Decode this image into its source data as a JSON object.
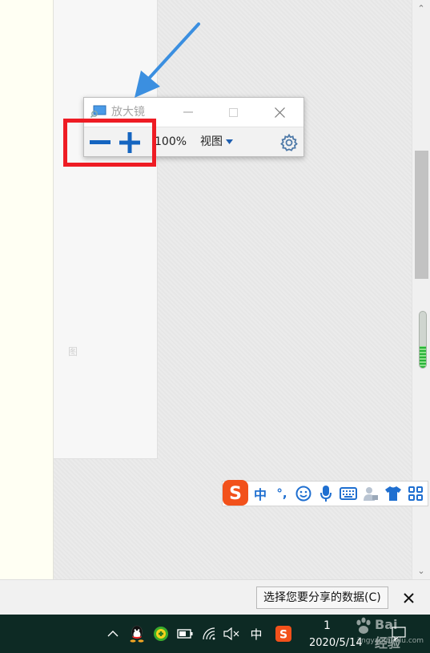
{
  "magnifier": {
    "title": "放大镜",
    "zoom_level": "100%",
    "view_menu_label": "视图",
    "icons": [
      "magnifier-app-icon",
      "minimize-icon",
      "maximize-icon",
      "close-icon",
      "zoom-out-icon",
      "zoom-in-icon",
      "dropdown-arrow-icon",
      "gear-icon"
    ]
  },
  "document": {
    "ghost_text": "图"
  },
  "scrollbar": {
    "up_glyph": "⌃",
    "down_glyph": "⌄"
  },
  "ime_toolbar": {
    "mode_label": "中",
    "punct_label": "°,",
    "icons": [
      "sogou-logo-icon",
      "emoji-icon",
      "microphone-icon",
      "keyboard-icon",
      "user-icon",
      "skin-tshirt-icon",
      "toolbox-grid-icon"
    ]
  },
  "notification": {
    "share_button_label": "选择您要分享的数据(C)",
    "close_glyph": "✕"
  },
  "taskbar": {
    "input_mode": "中",
    "time_partial": "1",
    "date": "2020/5/14",
    "icons": [
      "chevron-up-icon",
      "qq-icon",
      "360-security-icon",
      "battery-icon",
      "wifi-icon",
      "volume-muted-icon",
      "sogou-tray-icon",
      "action-center-icon"
    ]
  },
  "watermark": {
    "text": "Bai 经验",
    "url": "jingyan.baidu.com"
  },
  "colors": {
    "annotation_red": "#ee1c24",
    "annotation_blue": "#3b8fe0",
    "zoom_button_blue": "#1565c0",
    "taskbar_bg": "#0d2a24",
    "ime_blue": "#1f6fd0",
    "sogou_orange": "#f2511b"
  }
}
